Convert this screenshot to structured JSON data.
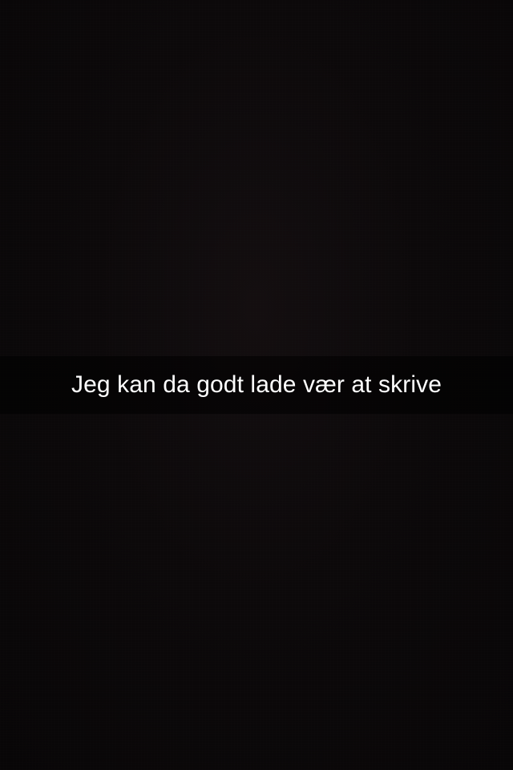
{
  "snap": {
    "caption": "Jeg kan da godt lade vær at skrive"
  },
  "colors": {
    "background": "#0a0809",
    "caption_bar": "rgba(0,0,0,0.55)",
    "caption_text": "#ffffff"
  }
}
